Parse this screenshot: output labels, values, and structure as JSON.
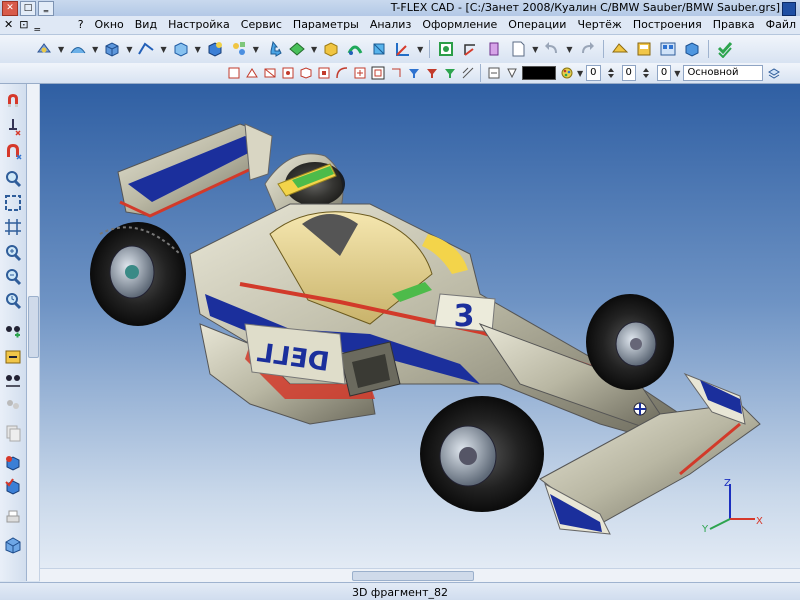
{
  "window": {
    "title": "T-FLEX CAD - [C:/Занет 2008/Куалин C/BMW Sauber/BMW Sauber.grs]",
    "close_label": "✕",
    "minimize_label": "‗",
    "maximize_label": "□"
  },
  "menu": {
    "items": [
      "Файл",
      "Правка",
      "Построения",
      "Чертёж",
      "Операции",
      "Оформление",
      "Анализ",
      "Параметры",
      "Сервис",
      "Настройка",
      "Вид",
      "Окно",
      "?"
    ],
    "left_controls": [
      "✕",
      "⊡",
      "‗"
    ]
  },
  "toolbar2": {
    "layer_value": "Основной",
    "number_value": "0",
    "number_value2": "0",
    "number_value3": "0",
    "color": "#000000"
  },
  "viewport": {
    "axis_x": "X",
    "axis_y": "Y",
    "axis_z": "Z",
    "car_number": "3",
    "sponsor": "DELL",
    "sponsor_side": "D",
    "colors": {
      "body": "#b9b7a3",
      "blue": "#1b2f9c",
      "red": "#d23a2a",
      "yellow": "#f3d44a",
      "green": "#4dbb4a",
      "tire": "#1c1c1c"
    }
  },
  "status": {
    "text": "3D фрагмент_82"
  },
  "icons": {
    "toolbar1": [
      "check-icon",
      "view-cube-icon",
      "view-icon",
      "save-icon",
      "copy-icon",
      "redo-icon",
      "undo-icon",
      "doc-icon",
      "measure-icon",
      "scale-icon",
      "rotate-icon",
      "coords-icon",
      "pan-icon",
      "sphere-icon",
      "shaded-icon",
      "section-icon",
      "move-icon",
      "parts-icon",
      "solid-icon",
      "cube-icon",
      "edge-icon",
      "box-icon",
      "surface-icon",
      "options-icon"
    ],
    "left": [
      "magnet-icon",
      "pin-icon",
      "snap-icon",
      "zoom-icon",
      "fit-icon",
      "frame-icon",
      "zoom-in-icon",
      "zoom-out-icon",
      "zoom-prev-icon",
      "points-icon",
      "pan-arrow-icon",
      "layers-icon",
      "copy-view-icon",
      "select-icon",
      "cube-select-icon",
      "print-icon",
      "iso-icon"
    ]
  }
}
